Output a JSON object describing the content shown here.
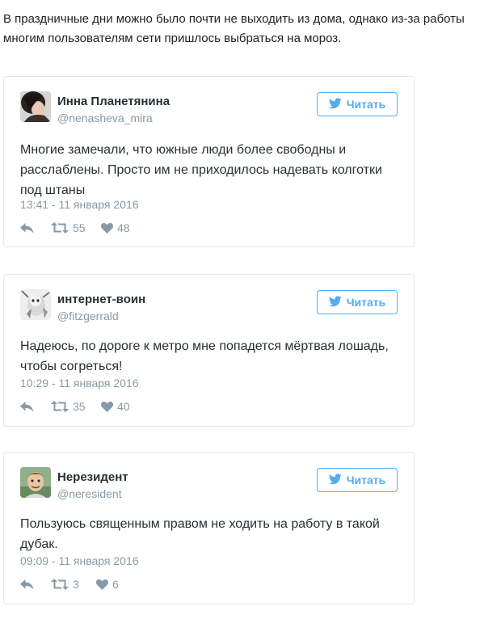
{
  "intro_text": "В праздничные дни можно было почти не выходить из дома, однако из-за работы многим пользователям сети пришлось выбраться на мороз.",
  "follow_label": "Читать",
  "colors": {
    "accent": "#55acee",
    "muted": "#8899a6",
    "border": "#e1e8ed"
  },
  "tweets": [
    {
      "name": "Инна Планетянина",
      "handle": "@nenasheva_mira",
      "text": "Многие замечали, что южные люди более свободны и расслаблены. Просто им не приходилось надевать колготки под штаны",
      "timestamp": "13:41 - 11 января 2016",
      "retweets": "55",
      "likes": "48"
    },
    {
      "name": "интернет-воин",
      "handle": "@fitzgerrald",
      "text": "Надеюсь, по дороге к метро мне попадется мёртвая лошадь, чтобы согреться!",
      "timestamp": "10:29 - 11 января 2016",
      "retweets": "35",
      "likes": "40"
    },
    {
      "name": "Нерезидент",
      "handle": "@neresident",
      "text": "Пользуюсь священным правом не ходить на работу в такой дубак.",
      "timestamp": "09:09 - 11 января 2016",
      "retweets": "3",
      "likes": "6"
    }
  ]
}
